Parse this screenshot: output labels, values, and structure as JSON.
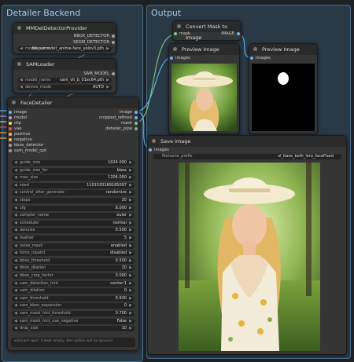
{
  "groups": {
    "left_title": "Detailer Backend",
    "right_title": "Output"
  },
  "mmdet": {
    "title": "MMDetDetectorProvider",
    "out1": "BBOX_DETECTOR",
    "out2": "SEGM_DETECTOR",
    "model_label": "model_name",
    "model_value": "bbox/mmdet_anime-face_yolov3.pth"
  },
  "sam": {
    "title": "SAMLoader",
    "out1": "SAM_MODEL",
    "model_label": "model_name",
    "model_value": "sam_vit_b_01ec64.pth",
    "device_label": "device_mode",
    "device_value": "AUTO"
  },
  "facedetailer": {
    "title": "FaceDetailer",
    "inputs": [
      "image",
      "model",
      "clip",
      "vae",
      "positive",
      "negative",
      "bbox_detector",
      "sam_model_opt"
    ],
    "input_colors": [
      "#64b5f6",
      "#b39ddb",
      "#ffd54f",
      "#ef5350",
      "#ffb74d",
      "#ffb74d",
      "#9e9e9e",
      "#9e9e9e"
    ],
    "outputs": [
      "image",
      "cropped_refined",
      "mask",
      "detailer_pipe"
    ],
    "output_colors": [
      "#64b5f6",
      "#64b5f6",
      "#81c784",
      "#9e9e9e"
    ],
    "widgets": [
      {
        "label": "guide_size",
        "value": "1024.000"
      },
      {
        "label": "guide_size_for",
        "value": "bbox"
      },
      {
        "label": "max_size",
        "value": "1204.000"
      },
      {
        "label": "seed",
        "value": "1101520189185097"
      },
      {
        "label": "control_after_generate",
        "value": "randomize"
      },
      {
        "label": "steps",
        "value": "20"
      },
      {
        "label": "cfg",
        "value": "8.000"
      },
      {
        "label": "sampler_name",
        "value": "euler"
      },
      {
        "label": "scheduler",
        "value": "normal"
      },
      {
        "label": "denoise",
        "value": "0.500"
      },
      {
        "label": "feather",
        "value": "5"
      },
      {
        "label": "noise_mask",
        "value": "enabled"
      },
      {
        "label": "force_inpaint",
        "value": "disabled"
      },
      {
        "label": "bbox_threshold",
        "value": "0.500"
      },
      {
        "label": "bbox_dilation",
        "value": "10"
      },
      {
        "label": "bbox_crop_factor",
        "value": "3.000"
      },
      {
        "label": "sam_detection_hint",
        "value": "center-1"
      },
      {
        "label": "sam_dilation",
        "value": "0"
      },
      {
        "label": "sam_threshold",
        "value": "0.930"
      },
      {
        "label": "sam_bbox_expansion",
        "value": "0"
      },
      {
        "label": "sam_mask_hint_threshold",
        "value": "0.700"
      },
      {
        "label": "sam_mask_hint_use_negative",
        "value": "False"
      },
      {
        "label": "drop_size",
        "value": "10"
      }
    ],
    "wildcard_text": "wildcard spec: if kept empty, this option will be ignored"
  },
  "convert": {
    "title": "Convert Mask to Image",
    "in1": "mask",
    "out1": "IMAGE"
  },
  "preview1": {
    "title": "Preview Image",
    "in1": "images"
  },
  "preview2": {
    "title": "Preview Image",
    "in1": "images"
  },
  "save": {
    "title": "Save Image",
    "in1": "images",
    "prefix_label": "filename_prefix",
    "prefix_value": "sl_base_both_lora_faceFixed"
  },
  "colors": {
    "image_wire": "#64b5f6",
    "mask_wire": "#81c784",
    "model_wire": "#b39ddb",
    "clip_wire": "#ffd54f",
    "vae_wire": "#ef5350",
    "cond_wire": "#ffb74d"
  }
}
